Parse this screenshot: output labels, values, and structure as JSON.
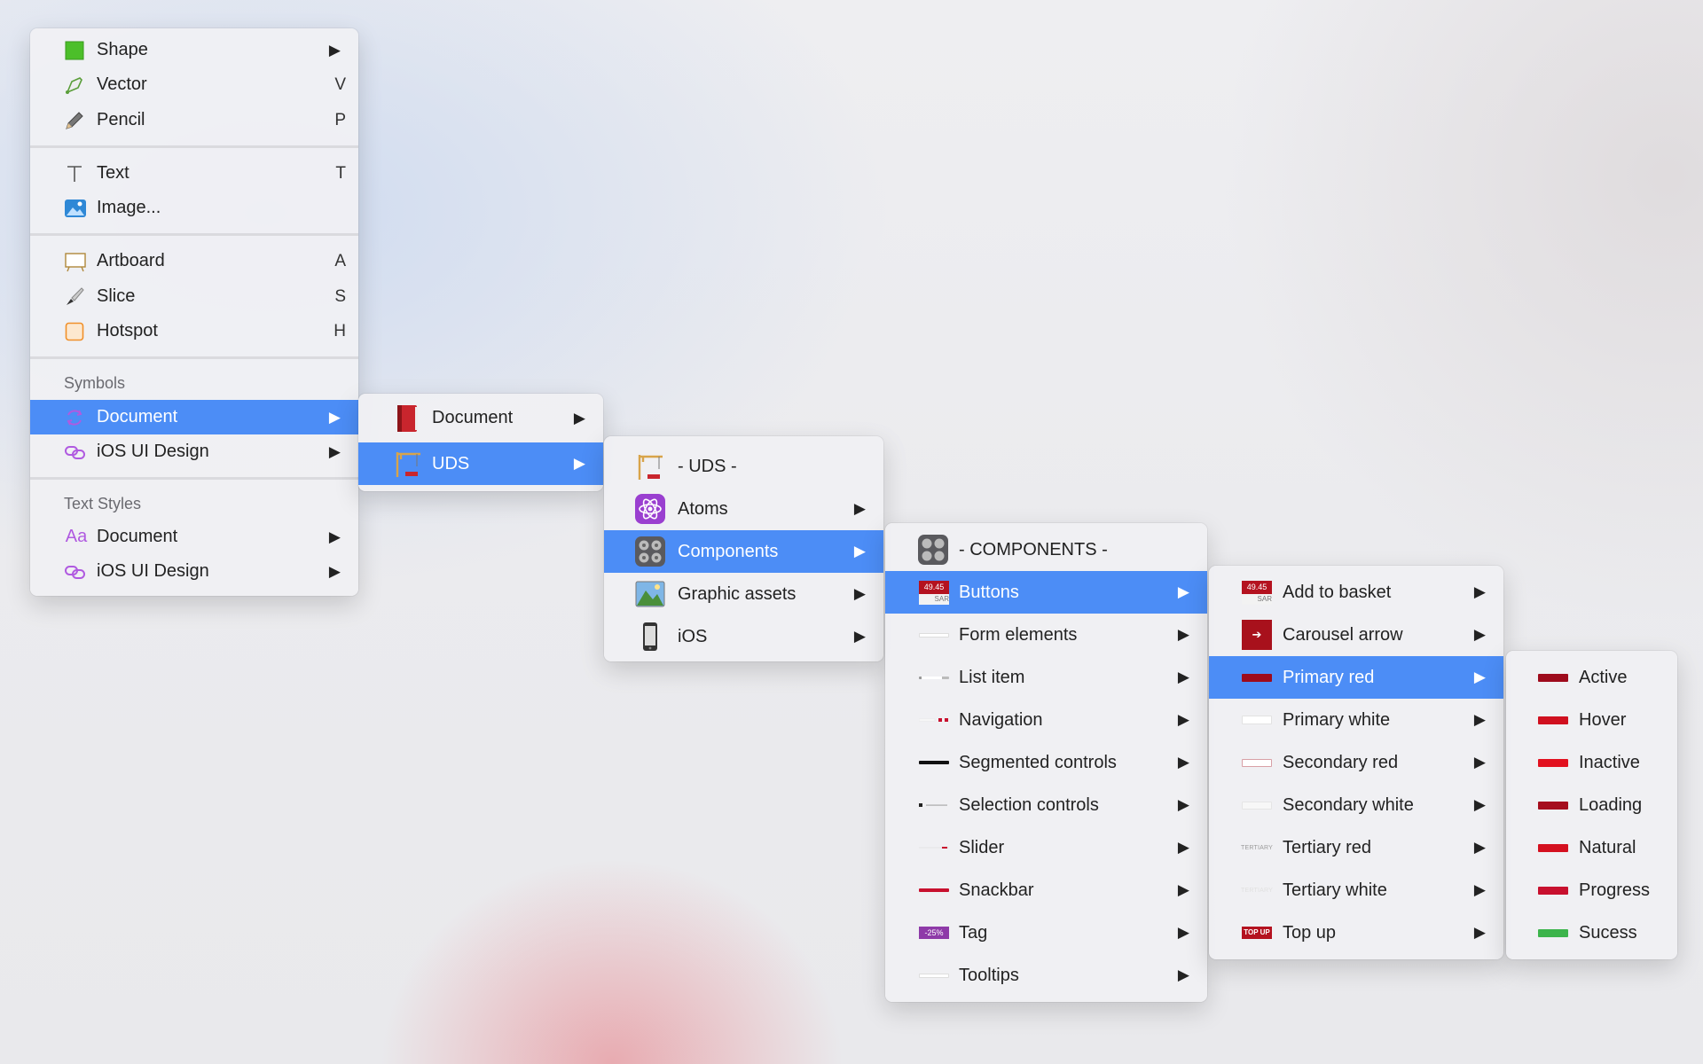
{
  "menu1": {
    "items": {
      "shape": {
        "label": "Shape"
      },
      "vector": {
        "label": "Vector",
        "shortcut": "V"
      },
      "pencil": {
        "label": "Pencil",
        "shortcut": "P"
      },
      "text": {
        "label": "Text",
        "shortcut": "T"
      },
      "image": {
        "label": "Image..."
      },
      "artboard": {
        "label": "Artboard",
        "shortcut": "A"
      },
      "slice": {
        "label": "Slice",
        "shortcut": "S"
      },
      "hotspot": {
        "label": "Hotspot",
        "shortcut": "H"
      }
    },
    "symbols_header": "Symbols",
    "symbols": {
      "document": "Document",
      "ios": "iOS UI Design"
    },
    "text_styles_header": "Text Styles",
    "text_styles": {
      "document": "Document",
      "ios": "iOS UI Design"
    },
    "selected": "Document"
  },
  "menu2": {
    "items": [
      "Document",
      "UDS"
    ],
    "selected": "UDS"
  },
  "menu3": {
    "items": [
      "- UDS -",
      "Atoms",
      "Components",
      "Graphic assets",
      "iOS"
    ],
    "selected": "Components"
  },
  "menu4": {
    "items": [
      "- COMPONENTS -",
      "Buttons",
      "Form elements",
      "List item",
      "Navigation",
      "Segmented controls",
      "Selection controls",
      "Slider",
      "Snackbar",
      "Tag",
      "Tooltips"
    ],
    "selected": "Buttons",
    "thumb_texts": {
      "buttons_price": "49.45",
      "buttons_currency": "SAR",
      "tag": "-25%"
    }
  },
  "menu5": {
    "items": [
      "Add to basket",
      "Carousel arrow",
      "Primary red",
      "Primary white",
      "Secondary red",
      "Secondary white",
      "Tertiary red",
      "Tertiary white",
      "Top up"
    ],
    "selected": "Primary red",
    "thumb_texts": {
      "price": "49.45",
      "currency": "SAR",
      "tertiary": "TERTIARY",
      "top_up": "TOP UP"
    }
  },
  "menu6": {
    "items": [
      "Active",
      "Hover",
      "Inactive",
      "Loading",
      "Natural",
      "Progress",
      "Sucess"
    ]
  },
  "colors": {
    "selection": "#4c8df6",
    "brand_red": "#c8102e",
    "dark_red": "#9e0b1c",
    "success_green": "#3cb44b"
  },
  "glyphs": {
    "submenu_arrow": "▶",
    "tag_arrow": "➔"
  }
}
